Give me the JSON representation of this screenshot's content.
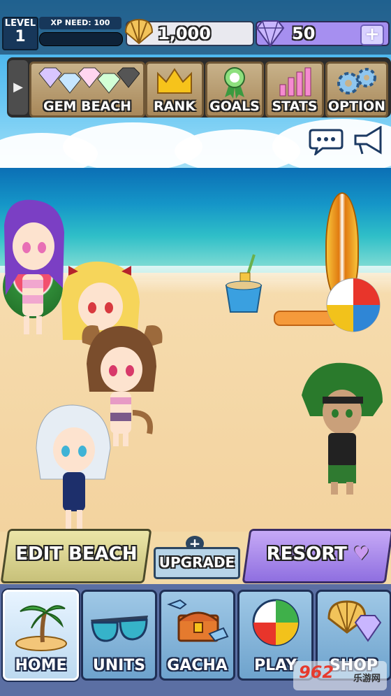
{
  "hud": {
    "level_label": "LEVEL",
    "level_value": "1",
    "xp_label": "XP NEED: 100",
    "xp_progress": 0,
    "coins": "1,000",
    "gems": "50",
    "coin_icon": "seashell-icon",
    "gem_icon": "diamond-icon"
  },
  "menu": {
    "items": [
      {
        "label": "GEM BEACH",
        "icon": "gems-row-icon"
      },
      {
        "label": "RANK",
        "icon": "crown-icon"
      },
      {
        "label": "GOALS",
        "icon": "ribbon-icon"
      },
      {
        "label": "STATS",
        "icon": "bar-chart-icon"
      },
      {
        "label": "OPTION",
        "icon": "gears-icon"
      }
    ]
  },
  "actions": {
    "edit_beach": "EDIT BEACH",
    "upgrade": "UPGRADE",
    "upgrade_plus": "+",
    "resort": "RESORT",
    "resort_heart": "♥"
  },
  "tabs": [
    {
      "label": "HOME",
      "icon": "palm-island-icon",
      "active": true
    },
    {
      "label": "UNITS",
      "icon": "sunglasses-icon",
      "active": false
    },
    {
      "label": "GACHA",
      "icon": "treasure-chest-icon",
      "active": false
    },
    {
      "label": "PLAY",
      "icon": "beach-ball-icon",
      "active": false
    },
    {
      "label": "SHOP",
      "icon": "shell-gem-icon",
      "active": false
    }
  ],
  "watermark": {
    "brand": "962",
    "text": "乐游网"
  },
  "colors": {
    "coin_bar": "#e9e9ef",
    "gem_bar": "#a68ff0",
    "menu_button": "#c8b28a",
    "resort": "#8f6fe0",
    "edit_beach": "#ebe6a8"
  }
}
